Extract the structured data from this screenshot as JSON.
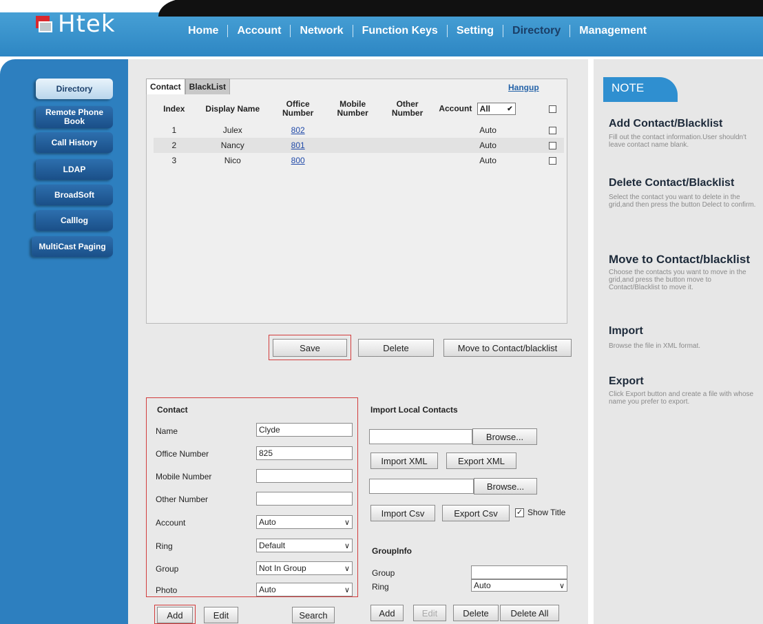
{
  "header": {
    "logo_text": "Htek",
    "nav": [
      "Home",
      "Account",
      "Network",
      "Function Keys",
      "Setting",
      "Directory",
      "Management"
    ],
    "active_nav": "Directory"
  },
  "sidebar": {
    "items": [
      "Directory",
      "Remote Phone Book",
      "Call History",
      "LDAP",
      "BroadSoft",
      "Calllog",
      "MultiCast Paging"
    ]
  },
  "grid": {
    "tabs": [
      "Contact",
      "BlackList"
    ],
    "hangup": "Hangup",
    "columns": [
      "Index",
      "Display Name",
      "Office Number",
      "Mobile Number",
      "Other Number",
      "Account"
    ],
    "account_filter": "All",
    "rows": [
      {
        "index": "1",
        "name": "Julex",
        "office": "802",
        "mobile": "",
        "other": "",
        "account": "Auto"
      },
      {
        "index": "2",
        "name": "Nancy",
        "office": "801",
        "mobile": "",
        "other": "",
        "account": "Auto"
      },
      {
        "index": "3",
        "name": "Nico",
        "office": "800",
        "mobile": "",
        "other": "",
        "account": "Auto"
      }
    ],
    "buttons": {
      "save": "Save",
      "delete": "Delete",
      "move": "Move to Contact/blacklist"
    }
  },
  "contact_form": {
    "title": "Contact",
    "labels": {
      "name": "Name",
      "office": "Office Number",
      "mobile": "Mobile Number",
      "other": "Other Number",
      "account": "Account",
      "ring": "Ring",
      "group": "Group",
      "photo": "Photo"
    },
    "values": {
      "name": "Clyde",
      "office": "825",
      "mobile": "",
      "other": "",
      "account": "Auto",
      "ring": "Default",
      "group": "Not In Group",
      "photo": "Auto"
    },
    "buttons": {
      "add": "Add",
      "edit": "Edit",
      "search": "Search"
    }
  },
  "import_local": {
    "title": "Import Local Contacts",
    "browse": "Browse...",
    "import_xml": "Import XML",
    "export_xml": "Export XML",
    "import_csv": "Import Csv",
    "export_csv": "Export Csv",
    "show_title": "Show Title"
  },
  "group_info": {
    "title": "GroupInfo",
    "group_label": "Group",
    "ring_label": "Ring",
    "group_value": "",
    "ring_value": "Auto",
    "buttons": {
      "add": "Add",
      "edit": "Edit",
      "delete": "Delete",
      "delete_all": "Delete All"
    }
  },
  "note": {
    "tab": "NOTE",
    "sections": [
      {
        "title": "Add Contact/Blacklist",
        "text": "Fill out the contact information.User shouldn't leave contact name blank."
      },
      {
        "title": "Delete Contact/Blacklist",
        "text": "Select the contact you want to delete in the grid,and then press the button Delect to confirm."
      },
      {
        "title": "Move to Contact/blacklist",
        "text": "Choose the contacts you want to move in the grid,and press the button move to Contact/Blacklist to move it."
      },
      {
        "title": "Import",
        "text": "Browse the file in XML format."
      },
      {
        "title": "Export",
        "text": "Click Export button and create a file with whose name you prefer to export."
      }
    ]
  }
}
